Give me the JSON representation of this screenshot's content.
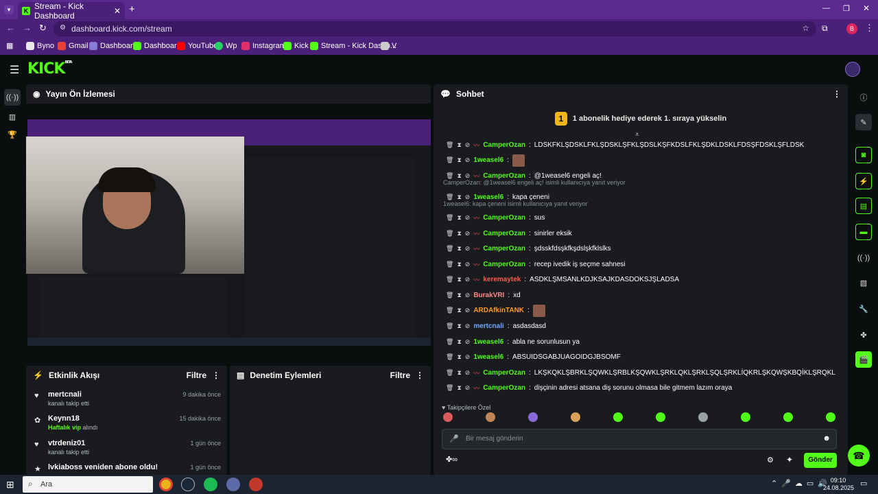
{
  "browser": {
    "tab_title": "Stream - Kick Dashboard",
    "url": "dashboard.kick.com/stream",
    "profile_initial": "B",
    "bookmarks": [
      {
        "label": "Byno",
        "color": "#e8e8e8"
      },
      {
        "label": "Gmail",
        "color": "#ea4335"
      },
      {
        "label": "Dashboard",
        "color": "#8a7ad8"
      },
      {
        "label": "Dashboard",
        "color": "#53fc18"
      },
      {
        "label": "YouTube",
        "color": "#ff0000"
      },
      {
        "label": "Wp",
        "color": "#25d366"
      },
      {
        "label": "Instagram",
        "color": "#e1306c"
      },
      {
        "label": "Kick",
        "color": "#53fc18"
      },
      {
        "label": "Stream - Kick Dashb...",
        "color": "#53fc18"
      },
      {
        "label": "V",
        "color": "#cccccc"
      }
    ]
  },
  "kick": {
    "logo": "KICK",
    "logo_beta": "BETA",
    "accent": "#53fc18"
  },
  "preview": {
    "title": "Yayın Ön İzlemesi"
  },
  "activity": {
    "title": "Etkinlik Akışı",
    "filter": "Filtre",
    "events": [
      {
        "name": "mertcnali",
        "sub": "kanalı takip etti",
        "time": "9 dakika önce",
        "icon": "heart-icon",
        "sub_highlight": false
      },
      {
        "name": "Keynn18",
        "sub_highlight_text": "Haftalık vip",
        "sub": "alındı",
        "time": "15 dakika önce",
        "icon": "gift-icon",
        "sub_highlight": true
      },
      {
        "name": "vtrdeniz01",
        "sub": "kanalı takip etti",
        "time": "1 gün önce",
        "icon": "heart-icon",
        "sub_highlight": false
      },
      {
        "name": "lvkiaboss veniden abone oldu!",
        "sub": "",
        "time": "1 gün önce",
        "icon": "star-icon",
        "sub_highlight": false
      }
    ]
  },
  "moderation": {
    "title": "Denetim Eylemleri",
    "filter": "Filtre"
  },
  "chat": {
    "title": "Sohbet",
    "banner_count": "1",
    "banner": "1 abonelik hediye ederek 1. sıraya yükselin",
    "messages": [
      {
        "user": "CamperOzan",
        "color": "#53fc18",
        "badge": true,
        "text": "LDSKFKLŞDSKLFKLŞDSKLŞFKLŞDSLKŞFKDSLFKLŞDKLDSKLFDSŞFDSKLŞFLDSK"
      },
      {
        "user": "1weasel6",
        "color": "#53fc18",
        "badge": false,
        "text": ""
      },
      {
        "user": "CamperOzan",
        "color": "#53fc18",
        "badge": true,
        "text": "@1weasel6 engeli aç!"
      },
      {
        "user": "1weasel6",
        "color": "#53fc18",
        "badge": false,
        "text": "kapa çeneni",
        "reply": "CamperOzan: @1weasel6 engeli aç! isimli kullanıcıya yanıt veriyor"
      },
      {
        "user": "CamperOzan",
        "color": "#53fc18",
        "badge": true,
        "text": "sus",
        "reply": "1weasel6: kapa çeneni isimli kullanıcıya yanıt veriyor"
      },
      {
        "user": "CamperOzan",
        "color": "#53fc18",
        "badge": true,
        "text": "sinirler eksik"
      },
      {
        "user": "CamperOzan",
        "color": "#53fc18",
        "badge": true,
        "text": "şdsskfdsşkfkşdslşkfklslks"
      },
      {
        "user": "CamperOzan",
        "color": "#53fc18",
        "badge": true,
        "text": "recep ivedik iş seçme sahnesi"
      },
      {
        "user": "keremaytek",
        "color": "#ff5a4e",
        "badge": true,
        "text": "ASDKLŞMSANLKDJKSAJKDASDOKSJŞLADSA"
      },
      {
        "user": "BurakVRI",
        "color": "#ff8a8a",
        "badge": false,
        "text": "xd"
      },
      {
        "user": "ARDAfkinTANK",
        "color": "#ff9b1a",
        "badge": false,
        "text": ""
      },
      {
        "user": "mertcnali",
        "color": "#6fa8ff",
        "badge": false,
        "text": "asdasdasd"
      },
      {
        "user": "1weasel6",
        "color": "#53fc18",
        "badge": false,
        "text": "abla ne sorunlusun ya"
      },
      {
        "user": "1weasel6",
        "color": "#53fc18",
        "badge": false,
        "text": "ABSUIDSGABJUAGOIDGJBSOMF"
      },
      {
        "user": "CamperOzan",
        "color": "#53fc18",
        "badge": true,
        "text": "LKŞKQKLŞBRKLŞQWKLŞRBLKŞQWKLŞRKLQKLŞRKLŞQLŞRKLİQKRLŞKQWŞKBQİKLŞRQKL"
      },
      {
        "user": "CamperOzan",
        "color": "#53fc18",
        "badge": true,
        "text": "dişçinin adresi atsana diş sorunu olmasa bile gitmem lazım oraya"
      }
    ],
    "followers_only": "Takipçilere Özel",
    "input_placeholder": "Bir mesaj gönderin",
    "send": "Gönder"
  },
  "taskbar": {
    "search": "Ara",
    "time": "09:10",
    "date": "24.08.2025"
  }
}
